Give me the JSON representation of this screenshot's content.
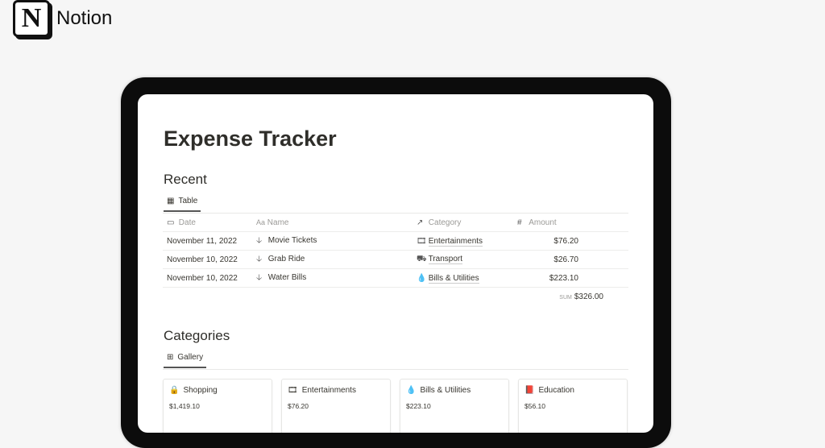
{
  "brand": {
    "name": "Notion",
    "logo_letter": "N"
  },
  "page": {
    "title": "Expense Tracker"
  },
  "recent": {
    "heading": "Recent",
    "view_tab": "Table",
    "columns": [
      "Date",
      "Name",
      "Category",
      "Amount"
    ],
    "rows": [
      {
        "date": "November 11, 2022",
        "name": "Movie Tickets",
        "category": "Entertainments",
        "category_icon": "film-icon",
        "amount": "$76.20"
      },
      {
        "date": "November 10, 2022",
        "name": "Grab Ride",
        "category": "Transport",
        "category_icon": "bus-icon",
        "amount": "$26.70"
      },
      {
        "date": "November 10, 2022",
        "name": "Water Bills",
        "category": "Bills & Utilities",
        "category_icon": "drop-icon",
        "amount": "$223.10"
      }
    ],
    "sum_label": "SUM",
    "sum_value": "$326.00"
  },
  "categories": {
    "heading": "Categories",
    "view_tab": "Gallery",
    "cards": [
      {
        "name": "Shopping",
        "icon": "bag-icon",
        "amount": "$1,419.10"
      },
      {
        "name": "Entertainments",
        "icon": "film-icon",
        "amount": "$76.20"
      },
      {
        "name": "Bills & Utilities",
        "icon": "drop-icon",
        "amount": "$223.10"
      },
      {
        "name": "Education",
        "icon": "book-icon",
        "amount": "$56.10"
      }
    ]
  }
}
